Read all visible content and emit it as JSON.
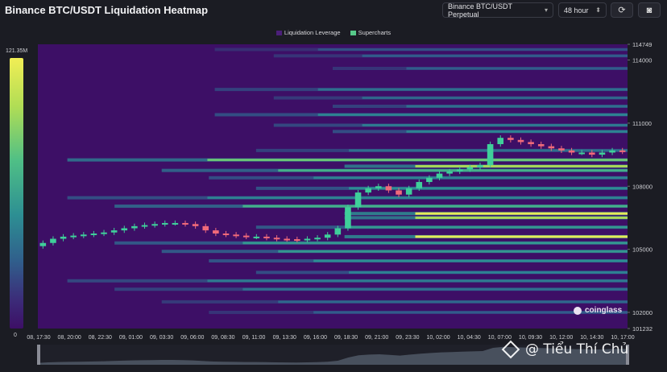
{
  "header": {
    "title": "Binance BTC/USDT Liquidation Heatmap",
    "pair_select": "Binance BTC/USDT Perpetual",
    "range_select": "48 hour",
    "refresh_icon": "refresh-icon",
    "camera_icon": "camera-icon"
  },
  "legend": {
    "items": [
      {
        "label": "Liquidation Leverage",
        "color": "#4b1f7a"
      },
      {
        "label": "Supercharts",
        "color": "#57c98a"
      }
    ]
  },
  "colorbar": {
    "max_label": "121.35M",
    "min_label": "0"
  },
  "brand": "coinglass",
  "watermark": "@ Tiểu Thí Chủ",
  "chart_data": {
    "type": "heatmap",
    "title": "Binance BTC/USDT Liquidation Heatmap",
    "x_tick_labels": [
      "08, 17:30",
      "08, 20:00",
      "08, 22:30",
      "09, 01:00",
      "09, 03:30",
      "09, 06:00",
      "09, 08:30",
      "09, 11:00",
      "09, 13:30",
      "09, 16:00",
      "09, 18:30",
      "09, 21:00",
      "09, 23:30",
      "10, 02:00",
      "10, 04:30",
      "10, 07:00",
      "10, 09:30",
      "10, 12:00",
      "10, 14:30",
      "10, 17:00"
    ],
    "y_tick_labels": [
      114749,
      114000,
      111000,
      108000,
      105000,
      102000,
      101232
    ],
    "ylim": [
      101232,
      114749
    ],
    "colorbar_range": [
      0,
      121.35
    ],
    "colorbar_unit": "M",
    "price_candles_close": [
      105300,
      105500,
      105600,
      105650,
      105700,
      105750,
      105800,
      105900,
      106000,
      106100,
      106150,
      106200,
      106250,
      106250,
      106200,
      106100,
      105900,
      105750,
      105700,
      105650,
      105600,
      105600,
      105550,
      105500,
      105480,
      105450,
      105500,
      105550,
      105700,
      106000,
      107000,
      107700,
      107900,
      108000,
      107800,
      107600,
      107900,
      108200,
      108400,
      108600,
      108700,
      108800,
      108900,
      109000,
      110000,
      110300,
      110200,
      110100,
      110000,
      109900,
      109800,
      109700,
      109600,
      109600,
      109500,
      109600,
      109700,
      109650
    ],
    "liquidation_bands": [
      {
        "price": 114500,
        "intensity": 0.25
      },
      {
        "price": 114200,
        "intensity": 0.3
      },
      {
        "price": 113600,
        "intensity": 0.3
      },
      {
        "price": 112600,
        "intensity": 0.4
      },
      {
        "price": 112200,
        "intensity": 0.35
      },
      {
        "price": 111800,
        "intensity": 0.4
      },
      {
        "price": 111400,
        "intensity": 0.5
      },
      {
        "price": 110900,
        "intensity": 0.45
      },
      {
        "price": 110600,
        "intensity": 0.5
      },
      {
        "price": 109700,
        "intensity": 0.4
      },
      {
        "price": 109250,
        "intensity": 0.8
      },
      {
        "price": 108950,
        "intensity": 0.9
      },
      {
        "price": 108750,
        "intensity": 0.7
      },
      {
        "price": 108400,
        "intensity": 0.5
      },
      {
        "price": 107900,
        "intensity": 0.55
      },
      {
        "price": 107450,
        "intensity": 0.5
      },
      {
        "price": 107050,
        "intensity": 0.7
      },
      {
        "price": 106700,
        "intensity": 1.0
      },
      {
        "price": 106500,
        "intensity": 0.9
      },
      {
        "price": 106050,
        "intensity": 0.6
      },
      {
        "price": 105600,
        "intensity": 1.0
      },
      {
        "price": 105300,
        "intensity": 0.6
      },
      {
        "price": 104900,
        "intensity": 0.6
      },
      {
        "price": 104450,
        "intensity": 0.55
      },
      {
        "price": 103900,
        "intensity": 0.5
      },
      {
        "price": 103500,
        "intensity": 0.45
      },
      {
        "price": 103100,
        "intensity": 0.4
      },
      {
        "price": 102500,
        "intensity": 0.35
      },
      {
        "price": 102000,
        "intensity": 0.3
      }
    ]
  }
}
